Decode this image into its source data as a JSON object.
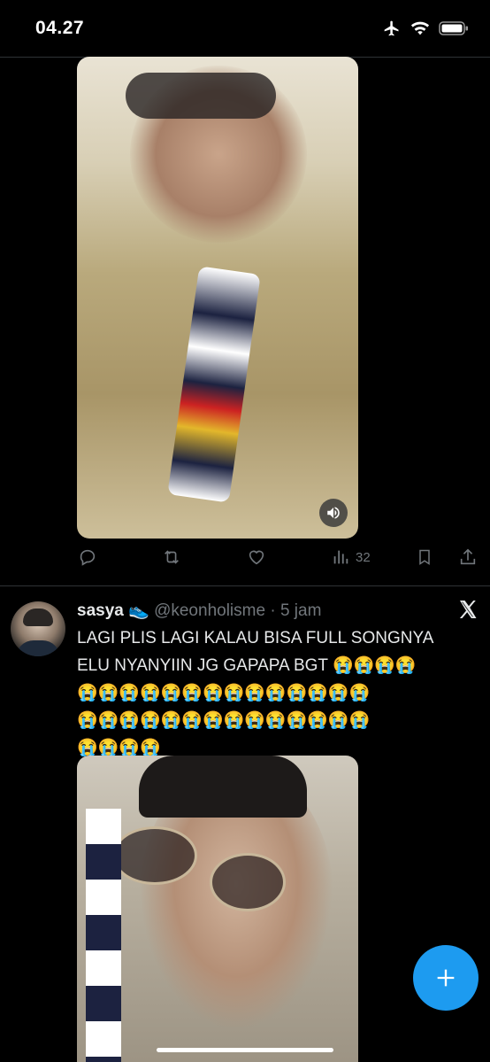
{
  "status_bar": {
    "time": "04.27",
    "icons": [
      "airplane-icon",
      "wifi-icon",
      "battery-icon"
    ]
  },
  "post1": {
    "media": {
      "kind": "video",
      "volume_icon": "speaker-icon"
    },
    "actions": {
      "reply_icon": "reply-icon",
      "repost_icon": "repost-icon",
      "like_icon": "heart-icon",
      "views_icon": "views-icon",
      "views_count": "32",
      "bookmark_icon": "bookmark-icon",
      "share_icon": "share-icon"
    }
  },
  "post2": {
    "author_name": "sasya",
    "author_emoji": "👟",
    "handle": "@keonholisme",
    "separator": "·",
    "time": "5 jam",
    "text_line1": "LAGI PLIS LAGI KALAU BISA FULL SONGNYA",
    "text_line2": "ELU NYANYIIN JG GAPAPA BGT 😭😭😭😭",
    "emoji_line3": "😭😭😭😭😭😭😭😭😭😭😭😭😭😭",
    "emoji_line4": "😭😭😭😭😭😭😭😭😭😭😭😭😭😭",
    "emoji_line5": "😭😭😭😭",
    "media": {
      "kind": "video"
    }
  },
  "fab": {
    "icon": "plus-icon"
  },
  "colors": {
    "accent": "#1d9bf0",
    "background": "#000000",
    "muted": "#71767b",
    "text": "#e7e9ea"
  }
}
